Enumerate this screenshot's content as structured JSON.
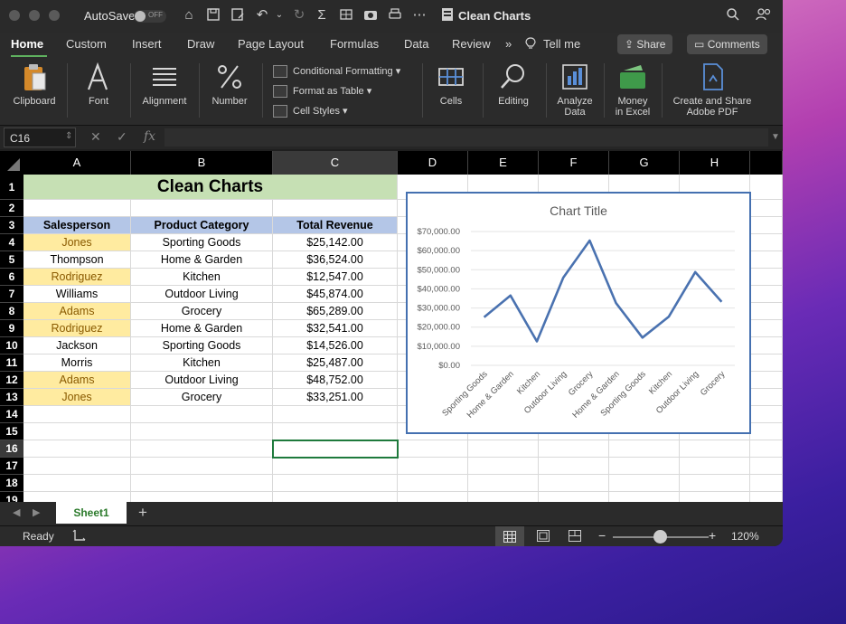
{
  "titlebar": {
    "autosave_label": "AutoSave",
    "autosave_state": "OFF",
    "doc_title": "Clean Charts"
  },
  "tabs": [
    "Home",
    "Custom",
    "Insert",
    "Draw",
    "Page Layout",
    "Formulas",
    "Data",
    "Review"
  ],
  "tell_me": "Tell me",
  "share_label": "Share",
  "comments_label": "Comments",
  "ribbon": {
    "clipboard": "Clipboard",
    "font": "Font",
    "alignment": "Alignment",
    "number": "Number",
    "conditional_formatting": "Conditional Formatting",
    "format_as_table": "Format as Table",
    "cell_styles": "Cell Styles",
    "cells": "Cells",
    "editing": "Editing",
    "analyze_data_1": "Analyze",
    "analyze_data_2": "Data",
    "money_1": "Money",
    "money_2": "in Excel",
    "adobe_1": "Create and Share",
    "adobe_2": "Adobe PDF"
  },
  "namebox": "C16",
  "fx_label": "fx",
  "columns": [
    "A",
    "B",
    "C",
    "D",
    "E",
    "F",
    "G",
    "H"
  ],
  "rows": [
    "1",
    "2",
    "3",
    "4",
    "5",
    "6",
    "7",
    "8",
    "9",
    "10",
    "11",
    "12",
    "13",
    "14",
    "15",
    "16",
    "17",
    "18",
    "19"
  ],
  "sheet": {
    "title": "Clean Charts",
    "headers": [
      "Salesperson",
      "Product Category",
      "Total Revenue"
    ],
    "data": [
      [
        "Jones",
        "Sporting Goods",
        "$25,142.00"
      ],
      [
        "Thompson",
        "Home & Garden",
        "$36,524.00"
      ],
      [
        "Rodriguez",
        "Kitchen",
        "$12,547.00"
      ],
      [
        "Williams",
        "Outdoor Living",
        "$45,874.00"
      ],
      [
        "Adams",
        "Grocery",
        "$65,289.00"
      ],
      [
        "Rodriguez",
        "Home & Garden",
        "$32,541.00"
      ],
      [
        "Jackson",
        "Sporting Goods",
        "$14,526.00"
      ],
      [
        "Morris",
        "Kitchen",
        "$25,487.00"
      ],
      [
        "Adams",
        "Outdoor Living",
        "$48,752.00"
      ],
      [
        "Jones",
        "Grocery",
        "$33,251.00"
      ]
    ],
    "highlighted_rows": [
      0,
      2,
      4,
      5,
      8,
      9
    ]
  },
  "chart_data": {
    "type": "line",
    "title": "Chart Title",
    "categories": [
      "Sporting Goods",
      "Home & Garden",
      "Kitchen",
      "Outdoor Living",
      "Grocery",
      "Home & Garden",
      "Sporting Goods",
      "Kitchen",
      "Outdoor Living",
      "Grocery"
    ],
    "series": [
      {
        "values": [
          25142,
          36524,
          12547,
          45874,
          65289,
          32541,
          14526,
          25487,
          48752,
          33251
        ]
      }
    ],
    "yticks": [
      "$0.00",
      "$10,000.00",
      "$20,000.00",
      "$30,000.00",
      "$40,000.00",
      "$50,000.00",
      "$60,000.00",
      "$70,000.00"
    ],
    "ylim": [
      0,
      70000
    ],
    "grid": true,
    "line_color": "#4a72b0"
  },
  "sheet_tab": "Sheet1",
  "add_sheet": "+",
  "status": {
    "ready": "Ready",
    "zoom": "120%",
    "minus": "−",
    "plus": "+"
  }
}
